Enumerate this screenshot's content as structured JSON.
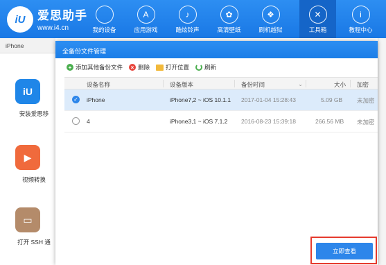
{
  "brand": {
    "logo": "iU",
    "name": "爱思助手",
    "url": "www.i4.cn"
  },
  "nav": [
    {
      "label": "我的设备",
      "icon": "apple-icon",
      "glyph": ""
    },
    {
      "label": "应用游戏",
      "icon": "appstore-icon",
      "glyph": "A"
    },
    {
      "label": "酷炫铃声",
      "icon": "bell-icon",
      "glyph": "♪"
    },
    {
      "label": "高清壁纸",
      "icon": "flower-icon",
      "glyph": "✿"
    },
    {
      "label": "刷机越狱",
      "icon": "dropbox-icon",
      "glyph": "❖"
    },
    {
      "label": "工具箱",
      "icon": "tools-icon",
      "glyph": "✕"
    },
    {
      "label": "教程中心",
      "icon": "info-icon",
      "glyph": "i"
    }
  ],
  "active_nav": "工具箱",
  "device_tab": "iPhone",
  "apps": [
    {
      "name": "安装爱思移",
      "icon": "i4-app-icon",
      "glyph": "iU",
      "color": "#1f86e8"
    },
    {
      "name": "视频转换",
      "icon": "video-convert-icon",
      "glyph": "▶",
      "color": "#f06a3c"
    },
    {
      "name": "打开 SSH 通",
      "icon": "ssh-terminal-icon",
      "glyph": "▭",
      "color": "#b48b6a"
    }
  ],
  "dialog": {
    "title": "全备份文件管理",
    "toolbar": {
      "add": "添加其他备份文件",
      "delete": "删除",
      "open_location": "打开位置",
      "refresh": "刷新"
    },
    "columns": {
      "name": "设备名称",
      "version": "设备版本",
      "time": "备份时间",
      "size": "大小",
      "encrypt": "加密"
    },
    "rows": [
      {
        "name": "iPhone",
        "version": "iPhone7,2 ~ iOS 10.1.1",
        "time": "2017-01-04 15:28:43",
        "size": "5.09 GB",
        "encrypt": "未加密",
        "selected": true
      },
      {
        "name": "4",
        "version": "iPhone3,1 ~ iOS 7.1.2",
        "time": "2016-08-23 15:39:18",
        "size": "266.56 MB",
        "encrypt": "未加密",
        "selected": false
      }
    ],
    "view_button": "立即查看"
  },
  "colors": {
    "accent": "#2d86ea",
    "highlight_border": "#e63b2e",
    "selected_row": "#dcebfb"
  }
}
